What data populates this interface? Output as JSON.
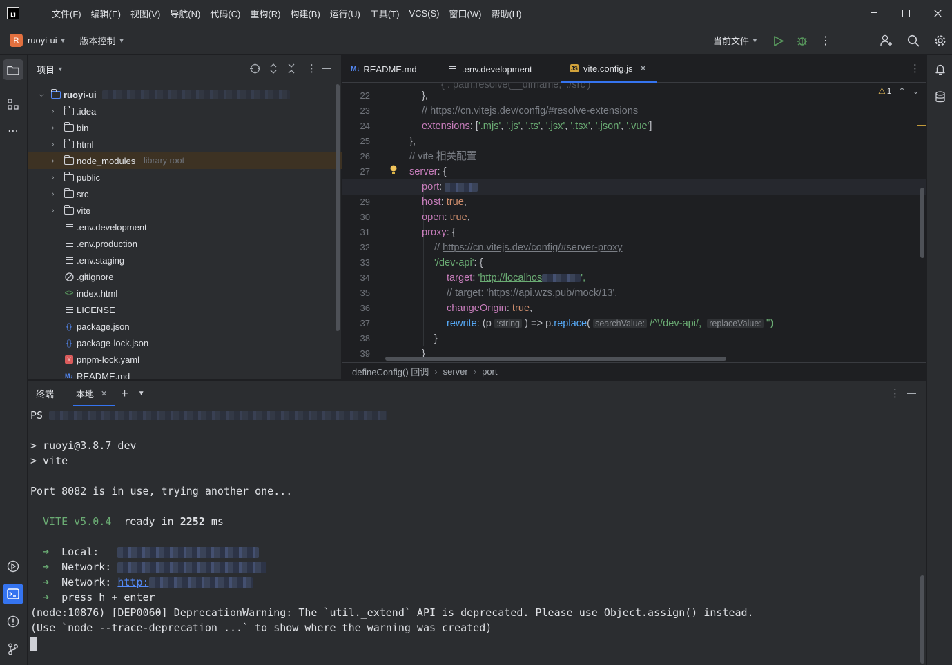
{
  "menu": [
    "文件(F)",
    "编辑(E)",
    "视图(V)",
    "导航(N)",
    "代码(C)",
    "重构(R)",
    "构建(B)",
    "运行(U)",
    "工具(T)",
    "VCS(S)",
    "窗口(W)",
    "帮助(H)"
  ],
  "toolbar": {
    "project_initial": "R",
    "project_name": "ruoyi-ui",
    "vcs_label": "版本控制",
    "run_config": "当前文件"
  },
  "project_panel": {
    "title": "项目",
    "root": "ruoyi-ui",
    "items": [
      {
        "name": ".idea",
        "type": "folder"
      },
      {
        "name": "bin",
        "type": "folder"
      },
      {
        "name": "html",
        "type": "folder"
      },
      {
        "name": "node_modules",
        "type": "folder",
        "hint": "library root"
      },
      {
        "name": "public",
        "type": "folder"
      },
      {
        "name": "src",
        "type": "folder"
      },
      {
        "name": "vite",
        "type": "folder"
      },
      {
        "name": ".env.development",
        "type": "text"
      },
      {
        "name": ".env.production",
        "type": "text"
      },
      {
        "name": ".env.staging",
        "type": "text"
      },
      {
        "name": ".gitignore",
        "type": "ignore"
      },
      {
        "name": "index.html",
        "type": "html"
      },
      {
        "name": "LICENSE",
        "type": "text"
      },
      {
        "name": "package.json",
        "type": "json"
      },
      {
        "name": "package-lock.json",
        "type": "json"
      },
      {
        "name": "pnpm-lock.yaml",
        "type": "yaml"
      },
      {
        "name": "README.md",
        "type": "md"
      }
    ]
  },
  "editor": {
    "tabs": [
      {
        "label": "README.md",
        "icon": "M↓"
      },
      {
        "label": ".env.development",
        "icon": "≡"
      },
      {
        "label": "vite.config.js",
        "icon": "JS",
        "active": true
      }
    ],
    "warning_count": "1",
    "gutter": [
      "22",
      "23",
      "24",
      "25",
      "26",
      "27",
      "28",
      "29",
      "30",
      "31",
      "32",
      "33",
      "34",
      "35",
      "36",
      "37",
      "38",
      "39"
    ],
    "code": {
      "l22": "},",
      "l23_prefix": "// ",
      "l23_link": "https://cn.vitejs.dev/config/#resolve-extensions",
      "l24_key": "extensions",
      "l24_rest": ": [",
      "l24_vals": [
        "'.mjs'",
        "'.js'",
        "'.ts'",
        "'.jsx'",
        "'.tsx'",
        "'.json'",
        "'.vue'"
      ],
      "l25": "},",
      "l26": "// vite 相关配置",
      "l27_key": "server",
      "l27_rest": ": {",
      "l28_key": "port",
      "l29_key": "host",
      "l29_val": "true",
      "l30_key": "open",
      "l30_val": "true",
      "l31_key": "proxy",
      "l31_rest": ": {",
      "l32_prefix": "// ",
      "l32_link": "https://cn.vitejs.dev/config/#server-proxy",
      "l33_str": "'/dev-api'",
      "l33_rest": ": {",
      "l34_key": "target",
      "l34_str_start": "'",
      "l34_link": "http://localhos",
      "l34_str_end": "',",
      "l35_prefix": "// target: '",
      "l35_link": "https://api.wzs.pub/mock/13",
      "l35_end": "',",
      "l36_key": "changeOrigin",
      "l36_val": "true",
      "l37_key": "rewrite",
      "l37_p": ": (p",
      "l37_hint_type": ":string",
      "l37_arrow": " ) => p.",
      "l37_fn": "replace",
      "l37_paren": "(",
      "l37_hint1": "searchValue:",
      "l37_regex": " /^\\/dev-api/,",
      "l37_hint2": "replaceValue:",
      "l37_end": " '')",
      "l38": "}",
      "l39": "}"
    },
    "breadcrumbs": [
      "defineConfig() 回调",
      "server",
      "port"
    ]
  },
  "terminal": {
    "title": "终端",
    "tab": "本地",
    "lines": {
      "ps": "PS",
      "cmd1": "> ruoyi@3.8.7 dev",
      "cmd2": "> vite",
      "port": "Port 8082 is in use, trying another one...",
      "vite_name": "VITE v5.0.4",
      "vite_ready": "ready in",
      "vite_ms": "2252",
      "vite_unit": "ms",
      "local": "Local:",
      "network1": "Network:",
      "network2": "Network:",
      "network2_link": "http:",
      "press": "press h + enter",
      "warn1": "(node:10876) [DEP0060] DeprecationWarning: The `util._extend` API is deprecated. Please use Object.assign() instead.",
      "warn2": "(Use `node --trace-deprecation ...` to show where the warning was created)"
    }
  },
  "colors": {
    "bg_editor": "#1e1f22",
    "bg_panel": "#2b2d30",
    "accent": "#3574f0",
    "string": "#6aab73",
    "keyword": "#cf8e6d",
    "property": "#c77dbb"
  }
}
